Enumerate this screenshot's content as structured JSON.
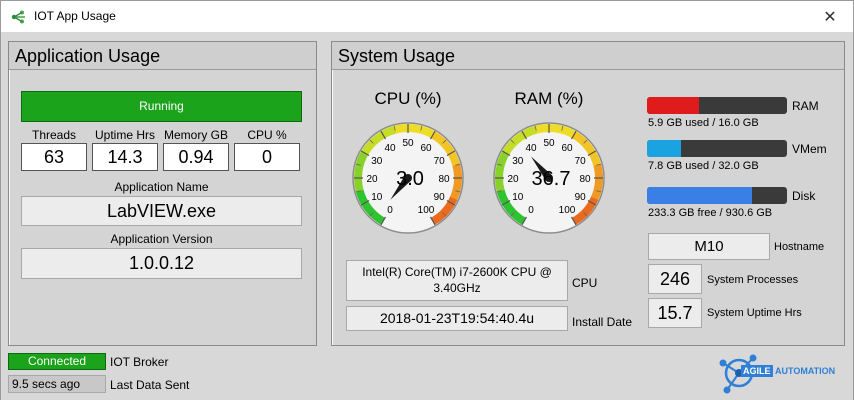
{
  "window": {
    "title": "IOT App Usage",
    "close_glyph": "✕"
  },
  "app_panel": {
    "heading": "Application Usage",
    "status": "Running",
    "status_color": "#1ba31b",
    "metrics": [
      {
        "label": "Threads",
        "value": "63"
      },
      {
        "label": "Uptime Hrs",
        "value": "14.3"
      },
      {
        "label": "Memory GB",
        "value": "0.94"
      },
      {
        "label": "CPU %",
        "value": "0"
      }
    ],
    "name_label": "Application Name",
    "name_value": "LabVIEW.exe",
    "version_label": "Application Version",
    "version_value": "1.0.0.12"
  },
  "system_panel": {
    "heading": "System Usage",
    "gauges": [
      {
        "title": "CPU (%)",
        "value": 3.0,
        "display": "3.0",
        "ticks": [
          "0",
          "10",
          "20",
          "30",
          "40",
          "50",
          "60",
          "70",
          "80",
          "90",
          "100"
        ]
      },
      {
        "title": "RAM (%)",
        "value": 36.7,
        "display": "36.7",
        "ticks": [
          "0",
          "10",
          "20",
          "30",
          "40",
          "50",
          "60",
          "70",
          "80",
          "90",
          "100"
        ]
      }
    ],
    "bars": [
      {
        "label": "RAM",
        "caption": "5.9 GB used / 16.0 GB",
        "fraction": 0.369,
        "color": "#e01b1b"
      },
      {
        "label": "VMem",
        "caption": "7.8 GB used / 32.0 GB",
        "fraction": 0.244,
        "color": "#1aa3e0"
      },
      {
        "label": "Disk",
        "caption": "233.3 GB free / 930.6 GB",
        "fraction": 0.749,
        "color": "#3a7fe6"
      }
    ],
    "cpu_value": "Intel(R) Core(TM) i7-2600K CPU @ 3.40GHz",
    "cpu_label": "CPU",
    "install_value": "2018-01-23T19:54:40.4u",
    "install_label": "Install Date",
    "hostname_value": "M10",
    "hostname_label": "Hostname",
    "processes_value": "246",
    "processes_label": "System Processes",
    "uptime_value": "15.7",
    "uptime_label": "System Uptime Hrs"
  },
  "footer": {
    "broker_status": "Connected",
    "broker_label": "IOT Broker",
    "last_sent_value": "9.5 secs ago",
    "last_sent_label": "Last Data Sent"
  },
  "logo": {
    "text_a": "AGILE",
    "text_b": "AUTOMATION",
    "color": "#2f7fd6"
  }
}
